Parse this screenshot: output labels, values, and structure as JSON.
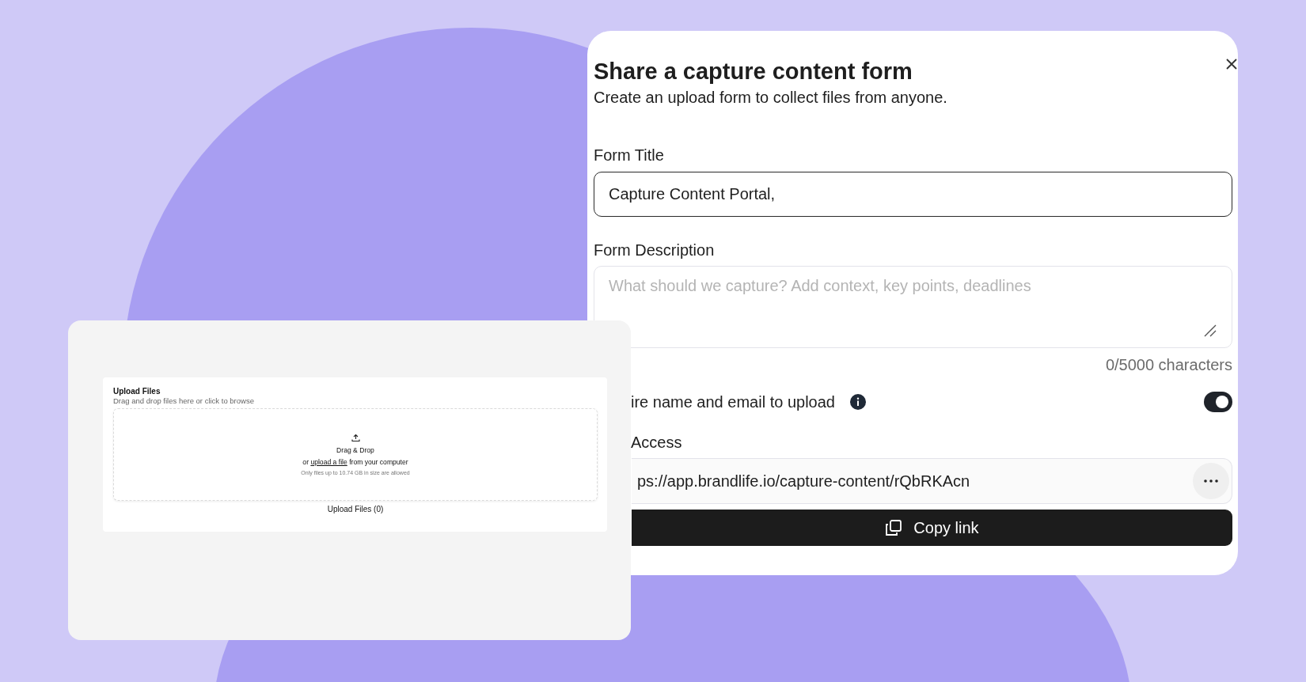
{
  "modal": {
    "title": "Share a capture content form",
    "subtitle": "Create an upload form to collect files from anyone.",
    "fields": [
      {
        "kind": "input",
        "label": "Form Title",
        "value": "Capture Content Portal,"
      },
      {
        "kind": "textarea",
        "label": "Form Description",
        "placeholder": "What should we capture? Add context, key points, deadlines",
        "counter": "0/5000 characters"
      }
    ],
    "require_toggle": {
      "label": "ire name and email to upload",
      "on": true
    },
    "access": {
      "label": "Access",
      "link": "ps://app.brandlife.io/capture-content/rQbRKAcn"
    },
    "copy_button": "Copy link"
  },
  "upload": {
    "title": "Upload Files",
    "hint": "Drag and drop files here or click to browse",
    "drop_title": "Drag & Drop",
    "drop_prefix": "or",
    "drop_link": "upload a file",
    "drop_suffix": "from your computer",
    "limit": "Only files up to 10.74 GB in size are allowed",
    "footer": "Upload Files (0)"
  }
}
